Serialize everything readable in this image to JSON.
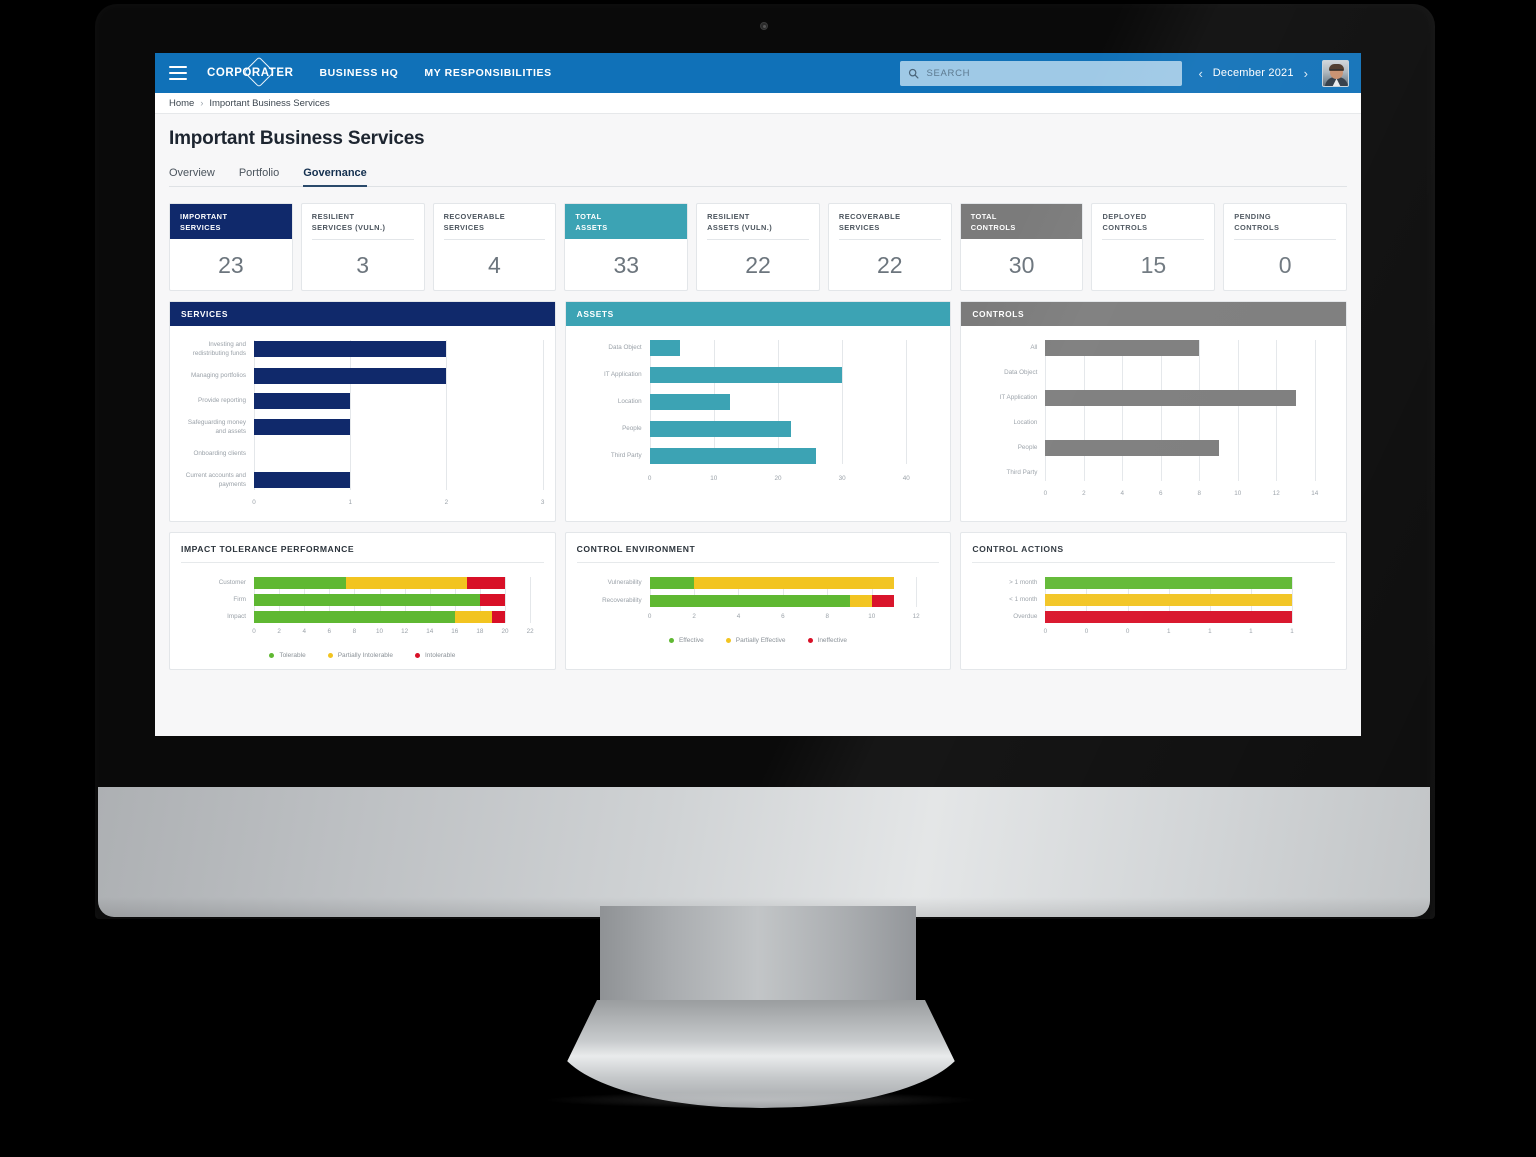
{
  "appbar": {
    "menu_icon": "hamburger-icon",
    "brand": "CORPORATER",
    "nav": [
      {
        "label": "BUSINESS HQ"
      },
      {
        "label": "MY RESPONSIBILITIES"
      }
    ],
    "search": {
      "placeholder": "SEARCH",
      "value": "",
      "icon": "search-icon"
    },
    "date_nav": {
      "prev": "‹",
      "label": "December 2021",
      "next": "›"
    },
    "avatar": "user-avatar"
  },
  "breadcrumb": {
    "home": "Home",
    "separator": "›",
    "current": "Important Business Services"
  },
  "page": {
    "title": "Important Business Services",
    "tabs": [
      {
        "label": "Overview",
        "active": false
      },
      {
        "label": "Portfolio",
        "active": false
      },
      {
        "label": "Governance",
        "active": true
      }
    ]
  },
  "kpis": [
    {
      "label": "IMPORTANT\nSERVICES",
      "value": "23",
      "style": "navy"
    },
    {
      "label": "RESILIENT\nSERVICES (VULN.)",
      "value": "3",
      "style": "plain"
    },
    {
      "label": "RECOVERABLE\nSERVICES",
      "value": "4",
      "style": "plain"
    },
    {
      "label": "TOTAL\nASSETS",
      "value": "33",
      "style": "teal"
    },
    {
      "label": "RESILIENT\nASSETS (VULN.)",
      "value": "22",
      "style": "plain"
    },
    {
      "label": "RECOVERABLE\nSERVICES",
      "value": "22",
      "style": "plain"
    },
    {
      "label": "TOTAL\nCONTROLS",
      "value": "30",
      "style": "grey"
    },
    {
      "label": "DEPLOYED\nCONTROLS",
      "value": "15",
      "style": "plain"
    },
    {
      "label": "PENDING\nCONTROLS",
      "value": "0",
      "style": "plain"
    }
  ],
  "cards": {
    "services": "SERVICES",
    "assets": "ASSETS",
    "controls": "CONTROLS",
    "impact_tolerance": "IMPACT TOLERANCE PERFORMANCE",
    "control_environment": "CONTROL ENVIRONMENT",
    "control_actions": "CONTROL ACTIONS"
  },
  "colors": {
    "brand_blue": "#1071b8",
    "navy": "#10296b",
    "teal": "#3ca3b4",
    "grey": "#7b7b7b",
    "green": "#5fb832",
    "yellow": "#f2c420",
    "red": "#d81027"
  },
  "chart_data": [
    {
      "id": "services",
      "type": "bar",
      "orientation": "horizontal",
      "title": "SERVICES",
      "categories": [
        "Investing and redistributing funds",
        "Managing portfolios",
        "Provide reporting",
        "Safeguarding money and assets",
        "Onboarding clients",
        "Current accounts and payments"
      ],
      "values": [
        2,
        2,
        1,
        1,
        0,
        1
      ],
      "color": "#10296b",
      "xlabel": "",
      "ylabel": "",
      "xlim": [
        0,
        3
      ],
      "ticks": [
        0,
        1,
        2,
        3
      ],
      "grid": true,
      "legend": null
    },
    {
      "id": "assets",
      "type": "bar",
      "orientation": "horizontal",
      "title": "ASSETS",
      "categories": [
        "Data Object",
        "IT Application",
        "Location",
        "People",
        "Third Party"
      ],
      "values": [
        4.7,
        30,
        12.5,
        22,
        26
      ],
      "color": "#3ca3b4",
      "xlabel": "",
      "ylabel": "",
      "xlim": [
        0,
        45
      ],
      "ticks": [
        0,
        10,
        20,
        30,
        40
      ],
      "grid": true,
      "legend": null
    },
    {
      "id": "controls",
      "type": "bar",
      "orientation": "horizontal",
      "title": "CONTROLS",
      "categories": [
        "All",
        "Data Object",
        "IT Application",
        "Location",
        "People",
        "Third Party"
      ],
      "values": [
        8,
        0,
        13,
        0,
        9,
        0
      ],
      "color": "#7b7b7b",
      "xlabel": "",
      "ylabel": "",
      "xlim": [
        0,
        15
      ],
      "ticks": [
        0,
        2,
        4,
        6,
        8,
        10,
        12,
        14
      ],
      "grid": true,
      "legend": null
    },
    {
      "id": "impact_tolerance",
      "type": "bar",
      "orientation": "horizontal",
      "stacked": true,
      "title": "IMPACT TOLERANCE PERFORMANCE",
      "categories": [
        "Customer",
        "Firm",
        "Impact"
      ],
      "series": [
        {
          "name": "Tolerable",
          "color": "#5fb832",
          "values": [
            7.3,
            18,
            16
          ]
        },
        {
          "name": "Partially Intolerable",
          "color": "#f2c420",
          "values": [
            9.7,
            0,
            3
          ]
        },
        {
          "name": "Intolerable",
          "color": "#d81027",
          "values": [
            3,
            2,
            1
          ]
        }
      ],
      "xlabel": "",
      "ylabel": "",
      "xlim": [
        0,
        23
      ],
      "ticks": [
        0,
        2,
        4,
        6,
        8,
        10,
        12,
        14,
        16,
        18,
        20,
        22
      ],
      "grid": true,
      "legend": [
        "Tolerable",
        "Partially Intolerable",
        "Intolerable"
      ],
      "legend_position": "bottom"
    },
    {
      "id": "control_environment",
      "type": "bar",
      "orientation": "horizontal",
      "stacked": true,
      "title": "CONTROL ENVIRONMENT",
      "categories": [
        "Vulnerability",
        "Recoverability"
      ],
      "series": [
        {
          "name": "Effective",
          "color": "#5fb832",
          "values": [
            2,
            9
          ]
        },
        {
          "name": "Partially Effective",
          "color": "#f2c420",
          "values": [
            9,
            1
          ]
        },
        {
          "name": "Ineffective",
          "color": "#d81027",
          "values": [
            0,
            1
          ]
        }
      ],
      "xlabel": "",
      "ylabel": "",
      "xlim": [
        0,
        13
      ],
      "ticks": [
        0,
        2,
        4,
        6,
        8,
        10,
        12
      ],
      "grid": true,
      "legend": [
        "Effective",
        "Partially Effective",
        "Ineffective"
      ],
      "legend_position": "bottom"
    },
    {
      "id": "control_actions",
      "type": "bar",
      "orientation": "horizontal",
      "title": "CONTROL ACTIONS",
      "categories": [
        "> 1 month",
        "< 1 month",
        "Overdue"
      ],
      "values": [
        1,
        1,
        1
      ],
      "bar_colors": [
        "#5fb832",
        "#f2c420",
        "#d81027"
      ],
      "xlabel": "",
      "ylabel": "",
      "xlim": [
        0,
        1.17
      ],
      "ticks": [
        0,
        0,
        0,
        1,
        1,
        1,
        1
      ],
      "grid": true,
      "legend": null
    }
  ]
}
